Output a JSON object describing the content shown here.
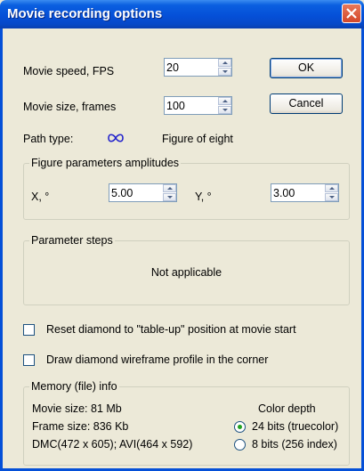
{
  "window": {
    "title": "Movie recording options"
  },
  "movie_speed": {
    "label": "Movie speed, FPS",
    "value": "20"
  },
  "movie_size": {
    "label": "Movie size, frames",
    "value": "100"
  },
  "buttons": {
    "ok": "OK",
    "cancel": "Cancel"
  },
  "path": {
    "label": "Path type:",
    "icon": "figure-eight-icon",
    "value": "Figure of eight"
  },
  "amplitudes": {
    "title": "Figure parameters amplitudes",
    "x_label": "X, °",
    "x_value": "5.00",
    "y_label": "Y, °",
    "y_value": "3.00"
  },
  "steps": {
    "title": "Parameter steps",
    "message": "Not applicable"
  },
  "options": {
    "reset": {
      "label": "Reset diamond to \"table-up\" position at movie start",
      "checked": false
    },
    "wireframe": {
      "label": "Draw diamond wireframe profile in the corner",
      "checked": false
    }
  },
  "memory": {
    "title": "Memory (file) info",
    "movie_size": "Movie size: 81 Mb",
    "frame_size": "Frame size: 836 Kb",
    "dims": "DMC(472 x 605); AVI(464 x 592)",
    "color_depth_label": "Color depth",
    "depth_24": {
      "label": "24 bits (truecolor)",
      "selected": true
    },
    "depth_8": {
      "label": "8 bits (256 index)",
      "selected": false
    }
  },
  "colors": {
    "titlebar": "#0550d8",
    "dialog_bg": "#ece9d8",
    "radio_dot": "#21a121"
  }
}
